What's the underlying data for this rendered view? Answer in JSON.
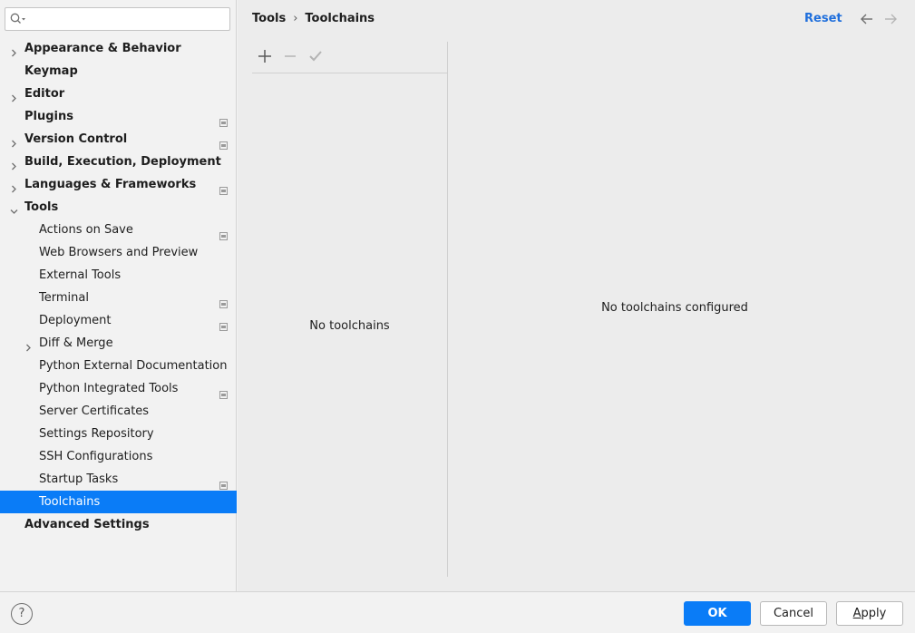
{
  "search": {
    "placeholder": ""
  },
  "sidebar": {
    "items": [
      {
        "label": "Appearance & Behavior",
        "level": 0,
        "expandable": true,
        "expanded": false,
        "project": false
      },
      {
        "label": "Keymap",
        "level": 0,
        "expandable": false,
        "project": false
      },
      {
        "label": "Editor",
        "level": 0,
        "expandable": true,
        "expanded": false,
        "project": false
      },
      {
        "label": "Plugins",
        "level": 0,
        "expandable": false,
        "project": true
      },
      {
        "label": "Version Control",
        "level": 0,
        "expandable": true,
        "expanded": false,
        "project": true
      },
      {
        "label": "Build, Execution, Deployment",
        "level": 0,
        "expandable": true,
        "expanded": false,
        "project": false
      },
      {
        "label": "Languages & Frameworks",
        "level": 0,
        "expandable": true,
        "expanded": false,
        "project": true
      },
      {
        "label": "Tools",
        "level": 0,
        "expandable": true,
        "expanded": true,
        "project": false
      },
      {
        "label": "Actions on Save",
        "level": 1,
        "expandable": false,
        "project": true
      },
      {
        "label": "Web Browsers and Preview",
        "level": 1,
        "expandable": false,
        "project": false
      },
      {
        "label": "External Tools",
        "level": 1,
        "expandable": false,
        "project": false
      },
      {
        "label": "Terminal",
        "level": 1,
        "expandable": false,
        "project": true
      },
      {
        "label": "Deployment",
        "level": 1,
        "expandable": false,
        "project": true
      },
      {
        "label": "Diff & Merge",
        "level": 1,
        "expandable": true,
        "expanded": false,
        "project": false
      },
      {
        "label": "Python External Documentation",
        "level": 1,
        "expandable": false,
        "project": false
      },
      {
        "label": "Python Integrated Tools",
        "level": 1,
        "expandable": false,
        "project": true
      },
      {
        "label": "Server Certificates",
        "level": 1,
        "expandable": false,
        "project": false
      },
      {
        "label": "Settings Repository",
        "level": 1,
        "expandable": false,
        "project": false
      },
      {
        "label": "SSH Configurations",
        "level": 1,
        "expandable": false,
        "project": false
      },
      {
        "label": "Startup Tasks",
        "level": 1,
        "expandable": false,
        "project": true
      },
      {
        "label": "Toolchains",
        "level": 1,
        "expandable": false,
        "project": false,
        "selected": true
      },
      {
        "label": "Advanced Settings",
        "level": 0,
        "expandable": false,
        "project": false
      }
    ]
  },
  "header": {
    "breadcrumb_parent": "Tools",
    "breadcrumb_separator": "›",
    "breadcrumb_current": "Toolchains",
    "reset_label": "Reset"
  },
  "toolbar": {
    "add_icon": "plus-icon",
    "remove_icon": "minus-icon",
    "default_icon": "check-icon"
  },
  "list": {
    "empty_text": "No toolchains"
  },
  "detail": {
    "empty_text": "No toolchains configured"
  },
  "footer": {
    "help_label": "?",
    "ok_label": "OK",
    "cancel_label": "Cancel",
    "apply_mnemonic": "A",
    "apply_rest": "pply"
  },
  "colors": {
    "accent": "#0a7cf7",
    "link": "#1f6fdc"
  }
}
